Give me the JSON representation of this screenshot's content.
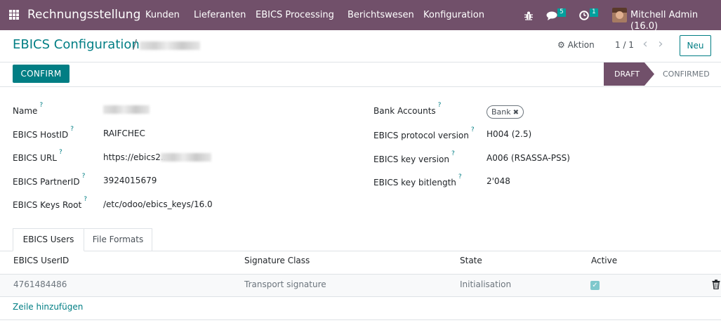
{
  "topnav": {
    "app_name": "Rechnungsstellung",
    "menu": [
      "Kunden",
      "Lieferanten",
      "EBICS Processing",
      "Berichtswesen",
      "Konfiguration"
    ],
    "messages_count": "5",
    "activities_count": "1",
    "user_name": "Mitchell Admin (16.0)",
    "brand_color": "#71506a"
  },
  "control_panel": {
    "breadcrumb_parent": "EBICS Configuration",
    "breadcrumb_separator": "/",
    "action_label": "Aktion",
    "pager_value": "1 / 1",
    "new_label": "Neu"
  },
  "statusbar": {
    "confirm_label": "CONFIRM",
    "stages": [
      "DRAFT",
      "CONFIRMED"
    ],
    "current_stage": "DRAFT"
  },
  "form": {
    "left": [
      {
        "label": "Name",
        "value": ""
      },
      {
        "label": "EBICS HostID",
        "value": "RAIFCHEC"
      },
      {
        "label": "EBICS URL",
        "value": "https://ebics2.r"
      },
      {
        "label": "EBICS PartnerID",
        "value": "3924015679"
      },
      {
        "label": "EBICS Keys Root",
        "value": "/etc/odoo/ebics_keys/16.0"
      }
    ],
    "right": [
      {
        "label": "Bank Accounts",
        "value": "Bank"
      },
      {
        "label": "EBICS protocol version",
        "value": "H004 (2.5)"
      },
      {
        "label": "EBICS key version",
        "value": "A006 (RSASSA-PSS)"
      },
      {
        "label": "EBICS key bitlength",
        "value": "2'048"
      }
    ],
    "help_mark": "?"
  },
  "tabs": [
    "EBICS Users",
    "File Formats"
  ],
  "table": {
    "headers": [
      "EBICS UserID",
      "Signature Class",
      "State",
      "Active"
    ],
    "rows": [
      {
        "user_id": "4761484486",
        "signature_class": "Transport signature",
        "state": "Initialisation",
        "active": true
      }
    ],
    "add_line_label": "Zeile hinzufügen"
  },
  "accent_color": "#017e84"
}
